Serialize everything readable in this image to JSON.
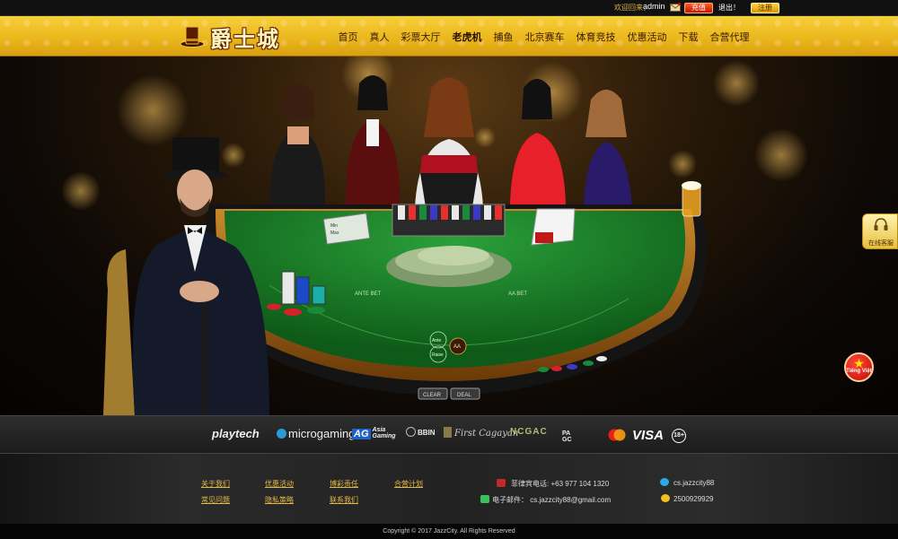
{
  "topbar": {
    "welcome": "欢迎回来，",
    "username": "admin",
    "deposit_label": "充值",
    "logout_label": "退出！",
    "register_label": "注册"
  },
  "header": {
    "logo_text": "爵士城",
    "nav": [
      "首页",
      "真人",
      "彩票大厅",
      "老虎机",
      "捕鱼",
      "北京赛车",
      "体育竞技",
      "优惠活动",
      "下载",
      "合营代理"
    ],
    "active_nav": "老虎机"
  },
  "banner": {
    "table": {
      "ante_bet": "ANTE BET",
      "aa_bet": "AA BET",
      "ante_button": "Ante",
      "raise_button": "Raise",
      "aa_button": "AA",
      "clear_button": "CLEAR",
      "deal_button": "DEAL",
      "card_min": "Min",
      "card_max": "Max"
    }
  },
  "side": {
    "service_label": "在线客服",
    "language_label": "Tiếng Việt"
  },
  "partners": {
    "playtech": "playtech",
    "microgaming": "microgaming",
    "ag_box": "AG",
    "ag_sub_1": "Asia",
    "ag_sub_2": "Gaming",
    "bbin": "BBIN",
    "first_cagayan": "First Cagayan",
    "ncgac": "NCGAC",
    "pagcor_1": "PA",
    "pagcor_2": "GC",
    "mastercard": "MasterCard",
    "visa": "VISA",
    "age": "18+"
  },
  "footer": {
    "links_row1": [
      "关于我们",
      "优惠活动",
      "博彩责任",
      "合营计划"
    ],
    "links_row2": [
      "常见问题",
      "隐私策略",
      "联系我们"
    ],
    "phone": "菲律宾电话: +63 977 104 1320",
    "email": "电子邮件： cs.jazzcity88@gmail.com",
    "skype": "cs.jazzcity88",
    "qq": "2500929929",
    "copyright": "Copyright © 2017 JazzCity. All Rights Reserved"
  },
  "colors": {
    "header_gold": "#e9b51b",
    "felt_green": "#1e7a2a",
    "link_gold": "#e2b84a",
    "deposit_red": "#d62a10"
  },
  "icons": [
    "mail-icon",
    "hat-logo-icon",
    "headset-icon",
    "vietnam-flag-icon",
    "phone-icon",
    "email-icon",
    "skype-icon",
    "qq-icon"
  ]
}
